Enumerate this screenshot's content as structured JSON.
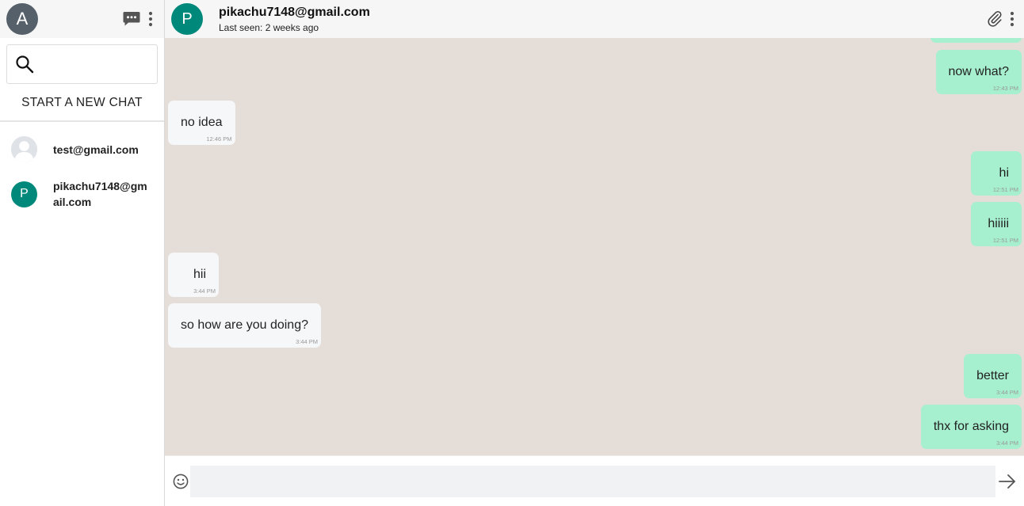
{
  "sidebar": {
    "user_avatar_letter": "A",
    "search": {
      "placeholder": "",
      "value": ""
    },
    "new_chat_label": "START A NEW CHAT",
    "chats": [
      {
        "name": "test@gmail.com",
        "avatar": "default-user-icon"
      },
      {
        "name": "pikachu7148@gmail.com",
        "avatar_letter": "P"
      }
    ]
  },
  "header": {
    "avatar_letter": "P",
    "title": "pikachu7148@gmail.com",
    "subtitle": "Last seen: 2 weeks ago"
  },
  "messages": [
    {
      "direction": "sent",
      "text": "",
      "time": ""
    },
    {
      "direction": "sent",
      "text": "now what?",
      "time": "12:43 PM"
    },
    {
      "direction": "received",
      "text": "no idea",
      "time": "12:46 PM"
    },
    {
      "direction": "sent",
      "text": "hi",
      "time": "12:51 PM"
    },
    {
      "direction": "sent",
      "text": "hiiiii",
      "time": "12:51 PM"
    },
    {
      "direction": "received",
      "text": "hii",
      "time": "3:44 PM"
    },
    {
      "direction": "received",
      "text": "so how are you doing?",
      "time": "3:44 PM"
    },
    {
      "direction": "sent",
      "text": "better",
      "time": "3:44 PM"
    },
    {
      "direction": "sent",
      "text": "thx for asking",
      "time": "3:44 PM"
    }
  ],
  "composer": {
    "placeholder": "",
    "value": ""
  },
  "colors": {
    "sent_bubble": "#a6f0cf",
    "received_bubble": "#f6f7f9",
    "chat_background": "#e5ddd8",
    "avatar_accent": "#00897b",
    "user_avatar": "#56606b"
  },
  "icons": {
    "new_chat": "chat-bubble-icon",
    "sidebar_menu": "more-vert-icon",
    "search": "search-icon",
    "attach": "paperclip-icon",
    "header_menu": "more-vert-icon",
    "emoji": "emoji-icon",
    "send": "arrow-right-icon"
  }
}
